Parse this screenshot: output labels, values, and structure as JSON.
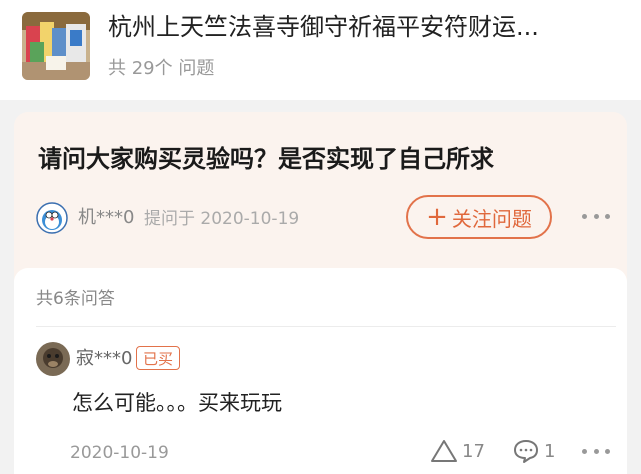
{
  "product": {
    "title": "杭州上天竺法喜寺御守祈福平安符财运...",
    "count": "共 29个 问题",
    "thumb_icon": "product-photo"
  },
  "question": {
    "text": "请问大家购买灵验吗？是否实现了自己所求",
    "asker": "机***0",
    "date": "提问于 2020-10-19",
    "follow_label": "关注问题",
    "avatar_icon": "cartoon-avatar"
  },
  "answers": {
    "count_label": "共6条问答",
    "items": [
      {
        "user": "寂***0",
        "badge": "已买",
        "text": "怎么可能。。。买来玩玩",
        "date": "2020-10-19",
        "likes": "17",
        "comments": "1"
      }
    ]
  },
  "colors": {
    "accent": "#e2724a",
    "question_bg": "#fbf3ee",
    "page_bg": "#f2f2f2"
  }
}
